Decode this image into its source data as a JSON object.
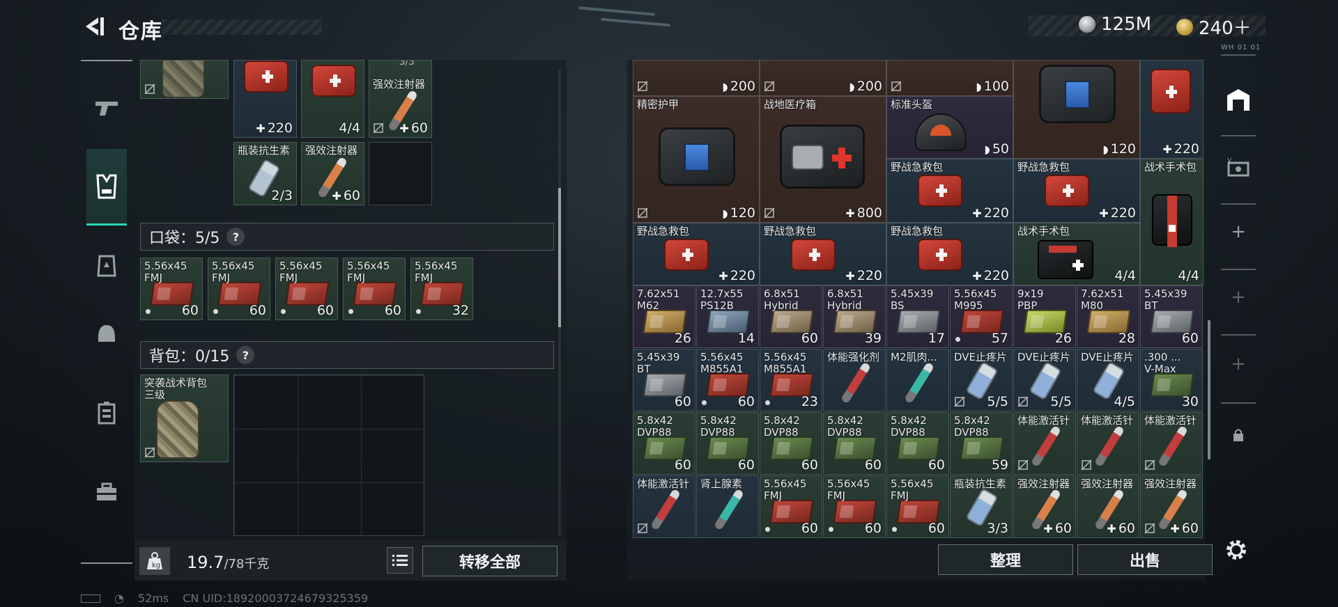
{
  "header": {
    "title": "仓库",
    "currency_silver": "125M",
    "currency_gold": "240＋"
  },
  "left_nav": {
    "items": [
      "weapon-icon",
      "vest-icon",
      "armor-icon",
      "helmet-icon",
      "chest-rig-icon",
      "toolbox-icon"
    ],
    "active": "vest-icon"
  },
  "loadout": {
    "top_cells": [
      {
        "name": "",
        "count": "",
        "prefix": "",
        "lock": true
      },
      {
        "name": "",
        "count": "220",
        "prefix": "✚",
        "lock": false
      },
      {
        "name": "",
        "count": "4/4",
        "prefix": "",
        "lock": false
      },
      {
        "name": "强效注射器",
        "count": "60",
        "prefix": "✚",
        "lock": true,
        "extra": "3/3"
      },
      {
        "name": "瓶装抗生素",
        "count": "2/3",
        "prefix": "",
        "lock": false
      },
      {
        "name": "强效注射器",
        "count": "60",
        "prefix": "✚",
        "lock": false
      }
    ],
    "pocket_label": "口袋：5/5",
    "pocket_items": [
      {
        "name": "5.56x45\nFMJ",
        "count": "60"
      },
      {
        "name": "5.56x45\nFMJ",
        "count": "60"
      },
      {
        "name": "5.56x45\nFMJ",
        "count": "60"
      },
      {
        "name": "5.56x45\nFMJ",
        "count": "60"
      },
      {
        "name": "5.56x45\nFMJ",
        "count": "32"
      }
    ],
    "backpack_label": "背包：0/15",
    "backpack_item": {
      "name": "突袭战术背包\n三级"
    },
    "help": "?"
  },
  "footer_left": {
    "weight_value": "19.7",
    "weight_max": "/78千克",
    "transfer_label": "转移全部"
  },
  "stash": {
    "sort_label": "整理",
    "sell_label": "出售",
    "top_partial": [
      {
        "count": "200",
        "prefix": "◗"
      },
      {
        "count": "200",
        "prefix": "◗"
      },
      {
        "count": "100",
        "prefix": "◗"
      }
    ],
    "cells": {
      "armor1": {
        "name": "精密护甲",
        "count": "120",
        "prefix": "◗"
      },
      "medkit_big": {
        "name": "战地医疗箱",
        "count": "800",
        "prefix": "✚"
      },
      "helmet": {
        "name": "标准头盔",
        "count": "50",
        "prefix": "◗"
      },
      "armor2": {
        "name": "",
        "count": "120",
        "prefix": "◗"
      },
      "medkit_small_top": {
        "name": "",
        "count": "220",
        "prefix": "✚"
      },
      "fak1": {
        "name": "野战急救包",
        "count": "220",
        "prefix": "✚"
      },
      "fak2": {
        "name": "野战急救包",
        "count": "220",
        "prefix": "✚"
      },
      "surg1": {
        "name": "战术手术包",
        "count": "4/4",
        "prefix": ""
      },
      "fak3": {
        "name": "野战急救包",
        "count": "220",
        "prefix": "✚"
      },
      "fak4": {
        "name": "野战急救包",
        "count": "220",
        "prefix": "✚"
      },
      "fak5": {
        "name": "野战急救包",
        "count": "220",
        "prefix": "✚"
      },
      "surg2": {
        "name": "战术手术包",
        "count": "4/4",
        "prefix": ""
      }
    },
    "ammo_row1": [
      {
        "name": "7.62x51\nM62",
        "count": "26",
        "color": "gold",
        "bg": "purple"
      },
      {
        "name": "12.7x55\nPS12B",
        "count": "14",
        "color": "blue",
        "bg": "purple"
      },
      {
        "name": "6.8x51\nHybrid",
        "count": "60",
        "color": "tan",
        "bg": "purple"
      },
      {
        "name": "6.8x51\nHybrid",
        "count": "39",
        "color": "tan",
        "bg": "purple"
      },
      {
        "name": "5.45x39\nBS",
        "count": "17",
        "color": "grey",
        "bg": "purple"
      },
      {
        "name": "5.56x45\nM995",
        "count": "57",
        "color": "red",
        "bg": "purple",
        "dot": true
      },
      {
        "name": "9x19\nPBP",
        "count": "26",
        "color": "yellow",
        "bg": "purple"
      },
      {
        "name": "7.62x51\nM80",
        "count": "28",
        "color": "gold",
        "bg": "purple"
      },
      {
        "name": "5.45x39\nBT",
        "count": "60",
        "color": "grey",
        "bg": "purple"
      }
    ],
    "row2": [
      {
        "name": "5.45x39\nBT",
        "count": "60",
        "kind": "ammo",
        "color": "grey",
        "bg": "blue"
      },
      {
        "name": "5.56x45\nM855A1",
        "count": "60",
        "kind": "ammo",
        "color": "red",
        "bg": "blue",
        "dot": true
      },
      {
        "name": "5.56x45\nM855A1",
        "count": "23",
        "kind": "ammo",
        "color": "red",
        "bg": "blue",
        "dot": true
      },
      {
        "name": "体能强化剂",
        "count": "",
        "kind": "syringe",
        "color": "red",
        "bg": "blue"
      },
      {
        "name": "M2肌肉...",
        "count": "",
        "kind": "syringe",
        "color": "teal",
        "bg": "blue"
      },
      {
        "name": "DVE止疼片",
        "count": "5/5",
        "kind": "pill",
        "bg": "blue",
        "lock": true
      },
      {
        "name": "DVE止疼片",
        "count": "5/5",
        "kind": "pill",
        "bg": "blue",
        "lock": true
      },
      {
        "name": "DVE止疼片",
        "count": "4/5",
        "kind": "pill",
        "bg": "blue"
      },
      {
        "name": ".300 ...\nV-Max",
        "count": "30",
        "kind": "ammo",
        "color": "green",
        "bg": "blue"
      }
    ],
    "row3": [
      {
        "name": "5.8x42\nDVP88",
        "count": "60",
        "kind": "ammo",
        "color": "green",
        "bg": "green"
      },
      {
        "name": "5.8x42\nDVP88",
        "count": "60",
        "kind": "ammo",
        "color": "green",
        "bg": "green"
      },
      {
        "name": "5.8x42\nDVP88",
        "count": "60",
        "kind": "ammo",
        "color": "green",
        "bg": "green"
      },
      {
        "name": "5.8x42\nDVP88",
        "count": "60",
        "kind": "ammo",
        "color": "green",
        "bg": "green"
      },
      {
        "name": "5.8x42\nDVP88",
        "count": "60",
        "kind": "ammo",
        "color": "green",
        "bg": "green"
      },
      {
        "name": "5.8x42\nDVP88",
        "count": "59",
        "kind": "ammo",
        "color": "green",
        "bg": "green"
      },
      {
        "name": "体能激活针",
        "count": "",
        "kind": "syringe",
        "color": "red",
        "bg": "green",
        "lock": true
      },
      {
        "name": "体能激活针",
        "count": "",
        "kind": "syringe",
        "color": "red",
        "bg": "green",
        "lock": true
      },
      {
        "name": "体能激活针",
        "count": "",
        "kind": "syringe",
        "color": "red",
        "bg": "green",
        "lock": true
      }
    ],
    "row4": [
      {
        "name": "体能激活针",
        "count": "",
        "kind": "syringe",
        "color": "red",
        "bg": "blue",
        "lock": true
      },
      {
        "name": "肾上腺素",
        "count": "",
        "kind": "syringe",
        "color": "teal",
        "bg": "blue"
      },
      {
        "name": "5.56x45\nFMJ",
        "count": "60",
        "kind": "ammo",
        "color": "red",
        "bg": "green",
        "dot": true
      },
      {
        "name": "5.56x45\nFMJ",
        "count": "60",
        "kind": "ammo",
        "color": "red",
        "bg": "green",
        "dot": true
      },
      {
        "name": "5.56x45\nFMJ",
        "count": "60",
        "kind": "ammo",
        "color": "red",
        "bg": "green",
        "dot": true
      },
      {
        "name": "瓶装抗生素",
        "count": "3/3",
        "kind": "pill",
        "bg": "green"
      },
      {
        "name": "强效注射器",
        "count": "60",
        "prefix": "✚",
        "kind": "syringe",
        "color": "orange",
        "bg": "green"
      },
      {
        "name": "强效注射器",
        "count": "60",
        "prefix": "✚",
        "kind": "syringe",
        "color": "orange",
        "bg": "green"
      },
      {
        "name": "强效注射器",
        "count": "60",
        "prefix": "✚",
        "kind": "syringe",
        "color": "orange",
        "bg": "green",
        "lock": true
      }
    ]
  },
  "right_nav": {
    "small_text": "WH 01 01"
  },
  "status": {
    "ping": "52ms",
    "uid": "CN UID:18920003724679325359"
  },
  "colors": {
    "accent": "#27d8b8",
    "panel_bg": "#1b2125",
    "cell_green": "#2a3c34",
    "cell_blue": "#24333f",
    "cell_purple": "#2e2b3d",
    "cell_brown": "#3c2c28"
  }
}
